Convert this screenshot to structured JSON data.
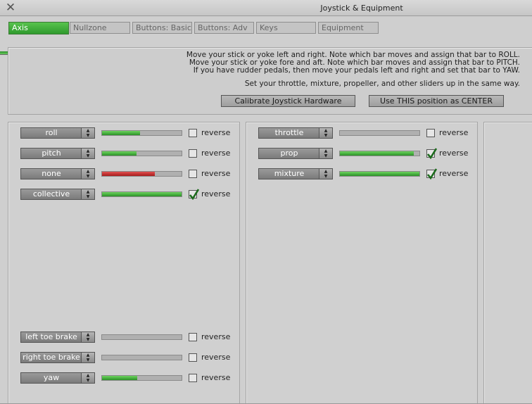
{
  "window": {
    "title": "Joystick & Equipment",
    "close_icon": "close-icon"
  },
  "tabs": [
    {
      "label": "Axis",
      "active": true
    },
    {
      "label": "Nullzone",
      "active": false
    },
    {
      "label": "Buttons: Basic",
      "active": false
    },
    {
      "label": "Buttons: Adv",
      "active": false
    },
    {
      "label": "Keys",
      "active": false
    },
    {
      "label": "Equipment",
      "active": false
    }
  ],
  "instructions": {
    "lines": [
      "Move your stick or yoke left and right. Note which bar moves and assign that bar to ROLL.",
      "Move your stick or yoke fore and aft. Note which bar moves and assign that bar to PITCH.",
      "If you have rudder pedals, then move your pedals left and right and set that bar to YAW.",
      "Set your throttle, mixture, propeller, and other sliders up in the same way."
    ],
    "calibrate_label": "Calibrate Joystick Hardware",
    "center_label": "Use THIS position as CENTER"
  },
  "reverse_label": "reverse",
  "axes_left": [
    {
      "axis": "roll",
      "level": 0.48,
      "color": "green",
      "reverse": false
    },
    {
      "axis": "pitch",
      "level": 0.43,
      "color": "green",
      "reverse": false
    },
    {
      "axis": "none",
      "level": 0.66,
      "color": "red",
      "reverse": false
    },
    {
      "axis": "collective",
      "level": 1.0,
      "color": "green",
      "reverse": true
    },
    {
      "axis": "left toe brake",
      "level": 0.0,
      "color": "green",
      "reverse": false
    },
    {
      "axis": "right toe brake",
      "level": 0.0,
      "color": "green",
      "reverse": false
    },
    {
      "axis": "yaw",
      "level": 0.44,
      "color": "green",
      "reverse": false
    }
  ],
  "axes_middle": [
    {
      "axis": "throttle",
      "level": 0.0,
      "color": "green",
      "reverse": false
    },
    {
      "axis": "prop",
      "level": 0.93,
      "color": "green",
      "reverse": true
    },
    {
      "axis": "mixture",
      "level": 1.0,
      "color": "green",
      "reverse": true
    }
  ],
  "colors": {
    "accent_green": "#2f9a2e",
    "alert_red": "#c02020"
  }
}
